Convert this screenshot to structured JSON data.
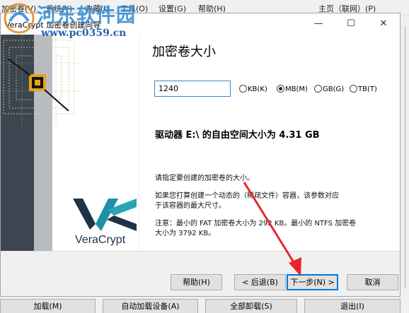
{
  "main_window": {
    "menu": [
      "加密卷(V)",
      "系统(Y)",
      "收藏(I)",
      "工具(O)",
      "设置(G)",
      "帮助(H)"
    ],
    "homepage": "主页（联网）(P)",
    "buttons": [
      "加载(M)",
      "自动加载设备(A)",
      "全部卸载(S)",
      "退出(I)"
    ]
  },
  "dialog": {
    "title": "VeraCrypt 加密卷创建向导",
    "brand": "VeraCrypt",
    "page_title": "加密卷大小",
    "size_value": "1240",
    "units": [
      {
        "label": "KB(K)",
        "selected": false
      },
      {
        "label": "MB(M)",
        "selected": true
      },
      {
        "label": "GB(G)",
        "selected": false
      },
      {
        "label": "TB(T)",
        "selected": false
      }
    ],
    "free_space": "驱动器 E:\\ 的自由空间大小为 4.31 GB",
    "hint1": "请指定要创建的加密卷的大小。",
    "hint2_line1": "如果您打算创建一个动态的（稀疏文件）容器，该参数对应",
    "hint2_line2": "于该容器的最大尺寸。",
    "hint3_line1": "注意：最小的 FAT 加密卷大小为 292 KB。最小的 NTFS 加密卷",
    "hint3_line2": "大小为 3792 KB。",
    "help_button": "帮助(H)",
    "back_button": "< 后退(B)",
    "next_button": "下一步(N) >",
    "cancel_button": "取消"
  },
  "watermark": {
    "site_name": "河东软件园",
    "url": "www.pc0359.cn"
  },
  "colors": {
    "accent": "#0078d7",
    "arrow": "#e8262a",
    "brand_dark": "#1f3347",
    "brand_teal": "#1f8fa3"
  }
}
